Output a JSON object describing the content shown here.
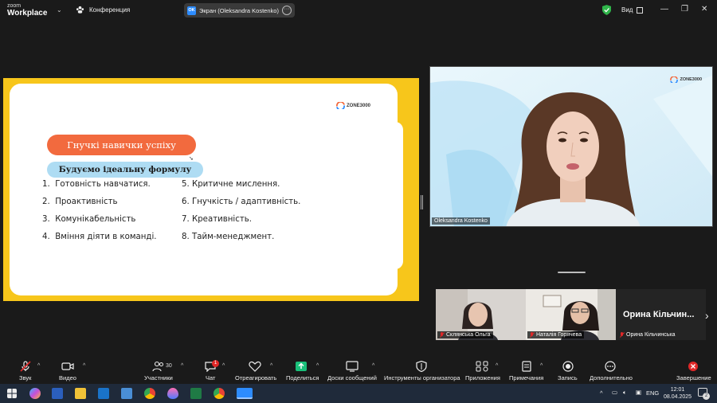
{
  "window": {
    "brand_top": "zoom",
    "brand_bottom": "Workplace",
    "conference_label": "Конференция",
    "screen_badge": "OK",
    "screen_label": "Экран (Oleksandra Kostenko)",
    "view_label": "Вид"
  },
  "slide": {
    "logo": "ZONE3000",
    "title": "Гнучкі навички успіху",
    "subtitle": "Будуємо ідеальну формулу",
    "left_items": [
      "Готовність навчатися.",
      "Проактивність",
      "Комунікабельність",
      "Вміння діяти в команді."
    ],
    "left_numbers": [
      "1.",
      "2.",
      "3.",
      "4."
    ],
    "right_items": [
      "Критичне мислення.",
      "Гнучкість / адаптивність.",
      "Креативність.",
      "Тайм-менеджмент."
    ],
    "right_numbers": [
      "5.",
      "6.",
      "7.",
      "8."
    ]
  },
  "main_video": {
    "logo": "ZONE3000",
    "name": "Oleksandra Kostenko"
  },
  "thumbnails": [
    {
      "name": "Склянська Ольга"
    },
    {
      "name": "Наталія Горячева"
    },
    {
      "name": "Орина Кільчинська",
      "display_name": "Орина Кільчин..."
    }
  ],
  "toolbar": {
    "audio": "Звук",
    "video": "Видео",
    "participants": "Участники",
    "participants_count": "30",
    "chat": "Чат",
    "chat_badge": "1",
    "react": "Отреагировать",
    "share": "Поделиться",
    "whiteboards": "Доски сообщений",
    "host_tools": "Инструменты организатора",
    "apps": "Приложения",
    "notes": "Примечания",
    "record": "Запись",
    "more": "Дополнительно",
    "end": "Завершение"
  },
  "taskbar": {
    "language": "ENG",
    "time": "12:01",
    "date": "08.04.2025",
    "notifications": "2"
  },
  "colors": {
    "slide_yellow": "#f7c61b",
    "title_orange": "#f26a3e",
    "subtitle_blue": "#aedcf3",
    "share_green": "#19c07a",
    "end_red": "#e02828"
  }
}
